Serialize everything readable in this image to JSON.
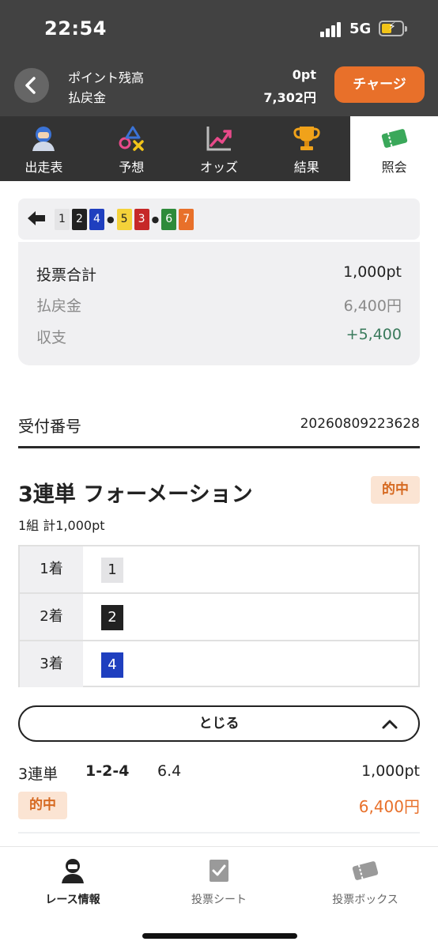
{
  "status_bar": {
    "time": "22:54",
    "network": "5G"
  },
  "header": {
    "points_label": "ポイント残高",
    "points_value": "0pt",
    "refund_label": "払戻金",
    "refund_value": "7,302円",
    "charge_label": "チャージ"
  },
  "tabs": [
    {
      "label": "出走表",
      "icon": "racer-icon"
    },
    {
      "label": "予想",
      "icon": "prediction-icon"
    },
    {
      "label": "オッズ",
      "icon": "odds-chart-icon"
    },
    {
      "label": "結果",
      "icon": "trophy-icon"
    },
    {
      "label": "照会",
      "icon": "ticket-icon",
      "active": true
    }
  ],
  "race_selector": {
    "numbers": [
      "1",
      "2",
      "4",
      "5",
      "3",
      "6",
      "7"
    ],
    "colors": {
      "1": "#e4e4e6",
      "2": "#222222",
      "4": "#1f3fbf",
      "5": "#f4d23a",
      "3": "#c62828",
      "6": "#2e8b3a",
      "7": "#e8702a"
    }
  },
  "summary": {
    "total_label": "投票合計",
    "total_value": "1,000pt",
    "payout_label": "払戻金",
    "payout_value": "6,400円",
    "balance_label": "収支",
    "balance_value": "+5,400"
  },
  "receipt": {
    "label": "受付番号",
    "value": "20260809223628"
  },
  "bet": {
    "title": "3連単 フォーメーション",
    "hit_badge": "的中",
    "subtitle": "1組 計1,000pt",
    "formation": [
      {
        "place": "1着",
        "number": "1"
      },
      {
        "place": "2着",
        "number": "2"
      },
      {
        "place": "3着",
        "number": "4"
      }
    ],
    "close_label": "とじる"
  },
  "result": {
    "type": "3連単",
    "combo": "1-2-4",
    "odds": "6.4",
    "amount": "1,000pt",
    "hit_badge": "的中",
    "payout": "6,400円"
  },
  "bottom_nav": [
    {
      "label": "レース情報",
      "icon": "racer-icon",
      "active": true
    },
    {
      "label": "投票シート",
      "icon": "sheet-check-icon"
    },
    {
      "label": "投票ボックス",
      "icon": "ticket-box-icon"
    }
  ],
  "accent_color": "#e8702a"
}
